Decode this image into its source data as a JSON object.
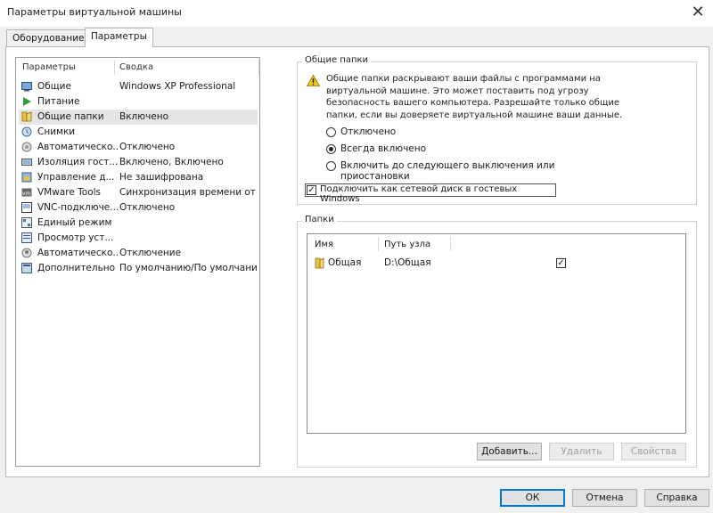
{
  "window": {
    "title": "Параметры виртуальной машины",
    "close_glyph": "✕"
  },
  "tabs": [
    {
      "label": "Оборудование",
      "active": false
    },
    {
      "label": "Параметры",
      "active": true
    }
  ],
  "settings_list": {
    "headers": {
      "name": "Параметры",
      "summary": "Сводка"
    },
    "rows": [
      {
        "name": "Общие",
        "value": "Windows XP Professional",
        "icon": "general-icon",
        "selected": false
      },
      {
        "name": "Питание",
        "value": "",
        "icon": "power-play-icon",
        "selected": false
      },
      {
        "name": "Общие папки",
        "value": "Включено",
        "icon": "shared-folder-icon",
        "selected": true
      },
      {
        "name": "Снимки",
        "value": "",
        "icon": "snapshot-icon",
        "selected": false
      },
      {
        "name": "Автоматическо...",
        "value": "Отключено",
        "icon": "autoprotect-icon",
        "selected": false
      },
      {
        "name": "Изоляция гост...",
        "value": "Включено, Включено",
        "icon": "isolation-icon",
        "selected": false
      },
      {
        "name": "Управление д...",
        "value": "Не зашифрована",
        "icon": "access-control-icon",
        "selected": false
      },
      {
        "name": "VMware Tools",
        "value": "Синхронизация времени от ...",
        "icon": "vmware-tools-icon",
        "selected": false
      },
      {
        "name": "VNC-подключе...",
        "value": "Отключено",
        "icon": "vnc-icon",
        "selected": false
      },
      {
        "name": "Единый режим",
        "value": "",
        "icon": "unity-icon",
        "selected": false
      },
      {
        "name": "Просмотр уст...",
        "value": "",
        "icon": "appliance-view-icon",
        "selected": false
      },
      {
        "name": "Автоматическо...",
        "value": "Отключение",
        "icon": "autologin-icon",
        "selected": false
      },
      {
        "name": "Дополнительно",
        "value": "По умолчанию/По умолчанию",
        "icon": "advanced-icon",
        "selected": false
      }
    ]
  },
  "shared_folders_group": {
    "label": "Общие папки",
    "warning": "Общие папки раскрывают ваши файлы с программами на виртуальной машине. Это может поставить под угрозу безопасность вашего компьютера. Разрешайте только общие папки, если вы доверяете виртуальной машине ваши данные.",
    "options": [
      {
        "label": "Отключено",
        "checked": false
      },
      {
        "label": "Всегда включено",
        "checked": true
      },
      {
        "label": "Включить до следующего выключения или приостановки",
        "checked": false
      }
    ],
    "map_drive": {
      "label": "Подключить как сетевой диск в гостевых Windows",
      "checked": true,
      "mark": "✓"
    }
  },
  "folders_group": {
    "label": "Папки",
    "columns": {
      "name": "Имя",
      "path": "Путь узла"
    },
    "rows": [
      {
        "name": "Общая",
        "path": "D:\\Общая",
        "enabled": true,
        "mark": "✓"
      }
    ],
    "buttons": {
      "add": "Добавить...",
      "remove": "Удалить",
      "properties": "Свойства"
    }
  },
  "footer": {
    "ok": "ОК",
    "cancel": "Отмена",
    "help": "Справка"
  },
  "colors": {
    "selection": "#e5e5e5",
    "accent": "#0078d7",
    "folder_yellow": "#e8c14a",
    "warning_yellow": "#f5c518"
  }
}
